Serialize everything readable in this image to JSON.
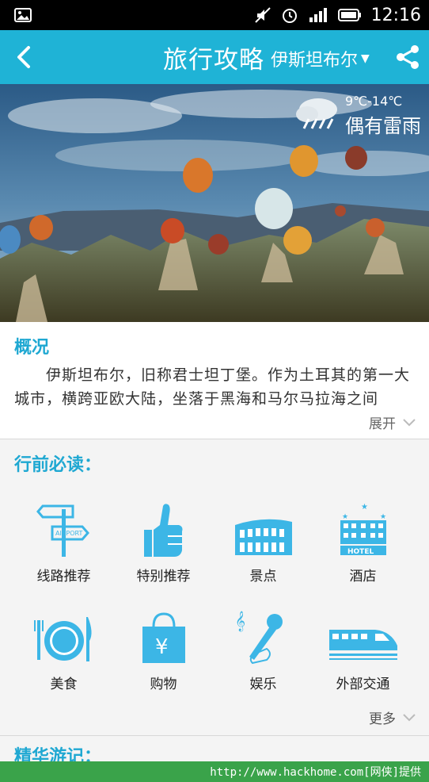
{
  "status_bar": {
    "time": "12:16"
  },
  "header": {
    "title": "旅行攻略",
    "city": "伊斯坦布尔"
  },
  "weather": {
    "temp": "9℃-14℃",
    "desc": "偶有雷雨"
  },
  "overview": {
    "title": "概况",
    "text": "伊斯坦布尔，旧称君士坦丁堡。作为土耳其的第一大城市，横跨亚欧大陆，坐落于黑海和马尔马拉海之间",
    "expand_label": "展开"
  },
  "mustread": {
    "title": "行前必读：",
    "items": [
      {
        "label": "线路推荐",
        "icon": "signpost-icon"
      },
      {
        "label": "特别推荐",
        "icon": "thumbs-up-icon"
      },
      {
        "label": "景点",
        "icon": "colosseum-icon"
      },
      {
        "label": "酒店",
        "icon": "hotel-icon"
      },
      {
        "label": "美食",
        "icon": "dining-icon"
      },
      {
        "label": "购物",
        "icon": "shopping-bag-icon"
      },
      {
        "label": "娱乐",
        "icon": "microphone-icon"
      },
      {
        "label": "外部交通",
        "icon": "train-icon"
      }
    ],
    "more_label": "更多"
  },
  "next_section": {
    "title": "精华游记："
  },
  "watermark": {
    "text": "http://www.hackhome.com[网侠]提供"
  },
  "colors": {
    "accent": "#1fb3d6",
    "icon": "#3cb6e6"
  }
}
